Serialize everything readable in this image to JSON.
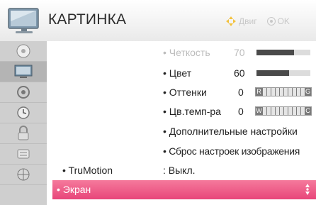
{
  "header": {
    "title": "КАРТИНКА",
    "nav_label": "Двиг",
    "ok_label": "OK",
    "icon": "tv-icon"
  },
  "sidebar": {
    "items": [
      {
        "icon": "disc-icon",
        "active": false
      },
      {
        "icon": "picture-icon",
        "active": true
      },
      {
        "icon": "audio-icon",
        "active": false
      },
      {
        "icon": "clock-icon",
        "active": false
      },
      {
        "icon": "lock-icon",
        "active": false
      },
      {
        "icon": "options-icon",
        "active": false
      },
      {
        "icon": "network-icon",
        "active": false
      }
    ]
  },
  "settings": {
    "sharpness": {
      "label": "• Четкость",
      "value": "70",
      "level": 0.7
    },
    "color": {
      "label": "• Цвет",
      "value": "60",
      "level": 0.6
    },
    "tint": {
      "label": "• Оттенки",
      "value": "0",
      "left": "R",
      "right": "G"
    },
    "color_temp": {
      "label": "• Цв.темп-ра",
      "value": "0",
      "left": "W",
      "right": "C"
    },
    "advanced": {
      "label": "• Дополнительные настройки"
    },
    "reset": {
      "label": "• Сброс настроек изображения"
    },
    "trumotion": {
      "label": "• TruMotion",
      "value": ": Выкл."
    },
    "screen": {
      "label": "• Экран"
    }
  },
  "colors": {
    "highlight": "#e8457a",
    "sidebar": "#cfcfcf"
  }
}
